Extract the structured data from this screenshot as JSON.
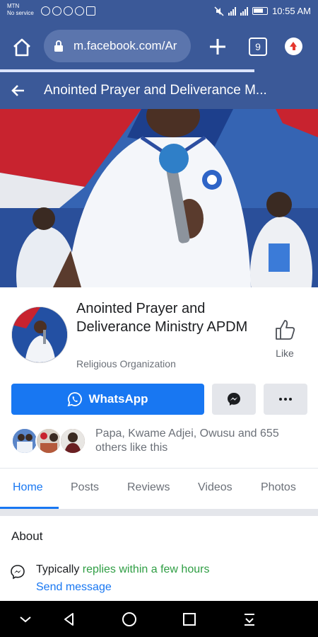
{
  "status_bar": {
    "carrier_line1": "MTN",
    "carrier_line2": "No service",
    "time": "10:55 AM"
  },
  "browser": {
    "url": "m.facebook.com/Ar",
    "tab_count": "9"
  },
  "header": {
    "title": "Anointed Prayer and Deliverance M..."
  },
  "page": {
    "name": "Anointed Prayer and Deliverance Ministry APDM",
    "category": "Religious Organization",
    "like_label": "Like"
  },
  "actions": {
    "whatsapp_label": "WhatsApp"
  },
  "likes": {
    "text": "Papa, Kwame Adjei, Owusu and 655 others like this"
  },
  "tabs": [
    "Home",
    "Posts",
    "Reviews",
    "Videos",
    "Photos"
  ],
  "active_tab": "Home",
  "about": {
    "title": "About",
    "reply_prefix": "Typically ",
    "reply_highlight": "replies within a few hours",
    "send_message": "Send message"
  },
  "colors": {
    "brand": "#3b5998",
    "accent": "#1877f2",
    "green": "#2f9e44"
  },
  "icons": [
    "home-icon",
    "lock-icon",
    "plus-icon",
    "tabs-icon",
    "update-icon",
    "back-arrow-icon",
    "thumbs-up-icon",
    "whatsapp-icon",
    "messenger-icon",
    "more-icon",
    "nav-down-icon",
    "nav-back-icon",
    "nav-home-icon",
    "nav-recents-icon",
    "nav-menu-icon"
  ]
}
